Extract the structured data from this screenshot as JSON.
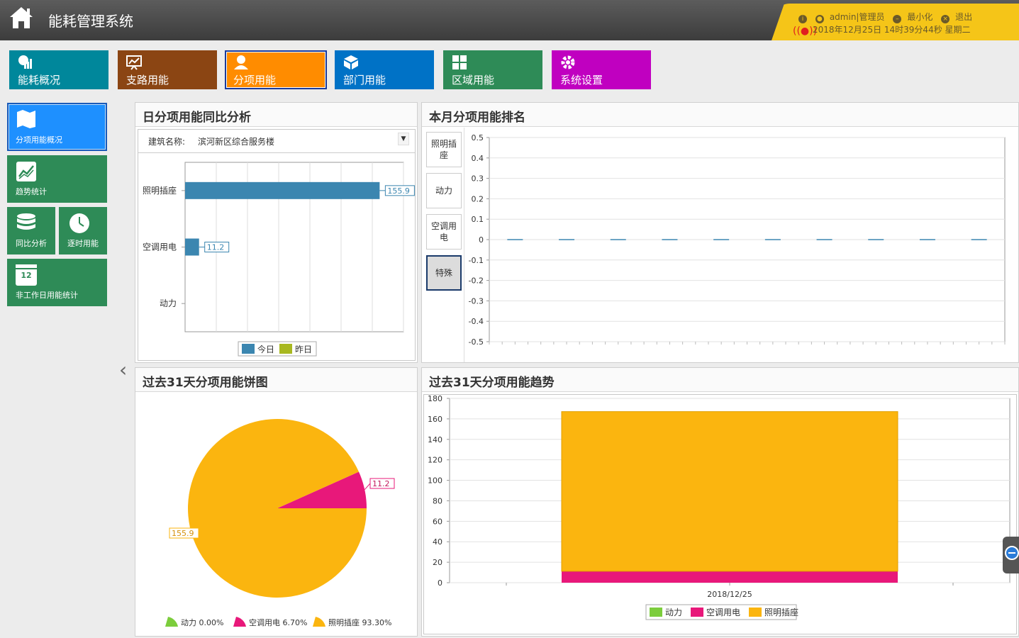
{
  "header": {
    "title": "能耗管理系统",
    "user": "admin|管理员",
    "minimize_label": "最小化",
    "logout_label": "退出",
    "datetime": "2018年12月25日 14时39分44秒 星期二"
  },
  "nav": {
    "items": [
      {
        "label": "能耗概况",
        "color": "#00879b",
        "icon": "chart-gauge-icon"
      },
      {
        "label": "支路用能",
        "color": "#8b4513",
        "icon": "presentation-chart-icon"
      },
      {
        "label": "分项用能",
        "color": "#ff8c00",
        "icon": "user-icon",
        "active": true
      },
      {
        "label": "部门用能",
        "color": "#0072c6",
        "icon": "cube-icon"
      },
      {
        "label": "区域用能",
        "color": "#2e8b57",
        "icon": "grid-icon"
      },
      {
        "label": "系统设置",
        "color": "#c000c0",
        "icon": "gear-icon"
      }
    ]
  },
  "sidebar": {
    "items": [
      {
        "label": "分项用能概况",
        "icon": "map-icon",
        "active": true
      },
      {
        "label": "趋势统计",
        "icon": "trend-icon"
      },
      {
        "label": "同比分析",
        "icon": "database-icon"
      },
      {
        "label": "逐时用能",
        "icon": "clock-icon"
      },
      {
        "label": "非工作日用能统计",
        "icon": "calendar-icon",
        "calendar_day": "12"
      }
    ]
  },
  "panels": {
    "daily": {
      "title": "日分项用能同比分析",
      "building_label": "建筑名称:",
      "building_value": "滨河新区综合服务楼"
    },
    "ranking": {
      "title": "本月分项用能排名",
      "buttons": [
        "照明插座",
        "动力",
        "空调用电",
        "特殊"
      ]
    },
    "pie": {
      "title": "过去31天分项用能饼图"
    },
    "trend": {
      "title": "过去31天分项用能趋势"
    }
  },
  "colors": {
    "today": "#3b86b0",
    "yesterday": "#a8b820",
    "power": "#7ccd3c",
    "ac": "#e8187a",
    "lighting": "#fbb50f"
  },
  "chart_data": [
    {
      "type": "bar",
      "orientation": "horizontal",
      "categories": [
        "照明插座",
        "空调用电",
        "动力"
      ],
      "series": [
        {
          "name": "今日",
          "values": [
            155.9,
            11.2,
            0
          ]
        },
        {
          "name": "昨日",
          "values": [
            0,
            0,
            0
          ]
        }
      ],
      "data_labels": [
        "155.9",
        "11.2",
        ""
      ],
      "xlim": [
        0,
        175
      ],
      "legend": "bottom"
    },
    {
      "type": "bar",
      "categories": [
        "",
        "",
        "",
        "",
        "",
        "",
        "",
        "",
        "",
        ""
      ],
      "values": [
        0,
        0,
        0,
        0,
        0,
        0,
        0,
        0,
        0,
        0
      ],
      "ylim": [
        -0.5,
        0.5
      ],
      "yticks": [
        "0.5",
        "0.4",
        "0.3",
        "0.2",
        "0.1",
        "0",
        "-0.1",
        "-0.2",
        "-0.3",
        "-0.4",
        "-0.5"
      ]
    },
    {
      "type": "pie",
      "slices": [
        {
          "name": "动力",
          "value": 0,
          "percent": "0.00%"
        },
        {
          "name": "空调用电",
          "value": 11.2,
          "percent": "6.70%"
        },
        {
          "name": "照明插座",
          "value": 155.9,
          "percent": "93.30%"
        }
      ],
      "labels": [
        "11.2",
        "155.9"
      ],
      "legend": "bottom"
    },
    {
      "type": "bar",
      "stacked": true,
      "categories": [
        "2018/12/25"
      ],
      "series": [
        {
          "name": "动力",
          "values": [
            0
          ]
        },
        {
          "name": "空调用电",
          "values": [
            11.2
          ]
        },
        {
          "name": "照明插座",
          "values": [
            155.9
          ]
        }
      ],
      "ylim": [
        0,
        180
      ],
      "yticks": [
        "0",
        "20",
        "40",
        "60",
        "80",
        "100",
        "120",
        "140",
        "160",
        "180"
      ],
      "legend": "bottom"
    }
  ]
}
